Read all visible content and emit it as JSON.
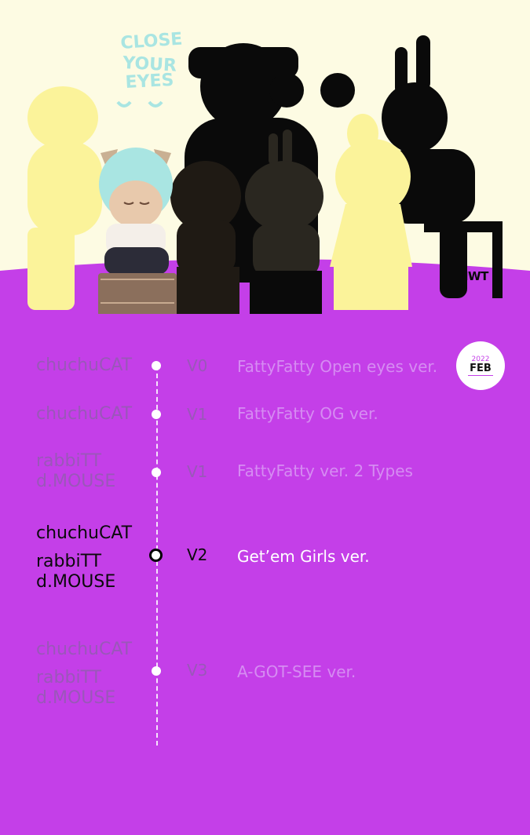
{
  "hero": {
    "logo_line1": "CLOSE",
    "logo_line2": "YOUR",
    "logo_line3": "EYES",
    "nwt_logo": "NWT"
  },
  "badge": {
    "year": "2022",
    "month": "FEB"
  },
  "timeline": [
    {
      "names": [
        "chuchuCAT"
      ],
      "version": "V0",
      "description": "FattyFatty Open eyes ver.",
      "active": false
    },
    {
      "names": [
        "chuchuCAT"
      ],
      "version": "V1",
      "description": "FattyFatty OG ver.",
      "active": false
    },
    {
      "names": [
        "rabbiTT",
        "d.MOUSE"
      ],
      "version": "V1",
      "description": "FattyFatty ver. 2 Types",
      "active": false
    },
    {
      "names": [
        "chuchuCAT",
        "rabbiTT",
        "d.MOUSE"
      ],
      "version": "V2",
      "description": "Get’em Girls ver.",
      "active": true
    },
    {
      "names": [
        "chuchuCAT",
        "rabbiTT",
        "d.MOUSE"
      ],
      "version": "V3",
      "description": "A-GOT-SEE ver.",
      "active": false
    }
  ],
  "colors": {
    "background": "#c43fe8",
    "cream": "#fdfbe3",
    "yellow": "#fbf39a",
    "mint": "#a9e5e2"
  }
}
